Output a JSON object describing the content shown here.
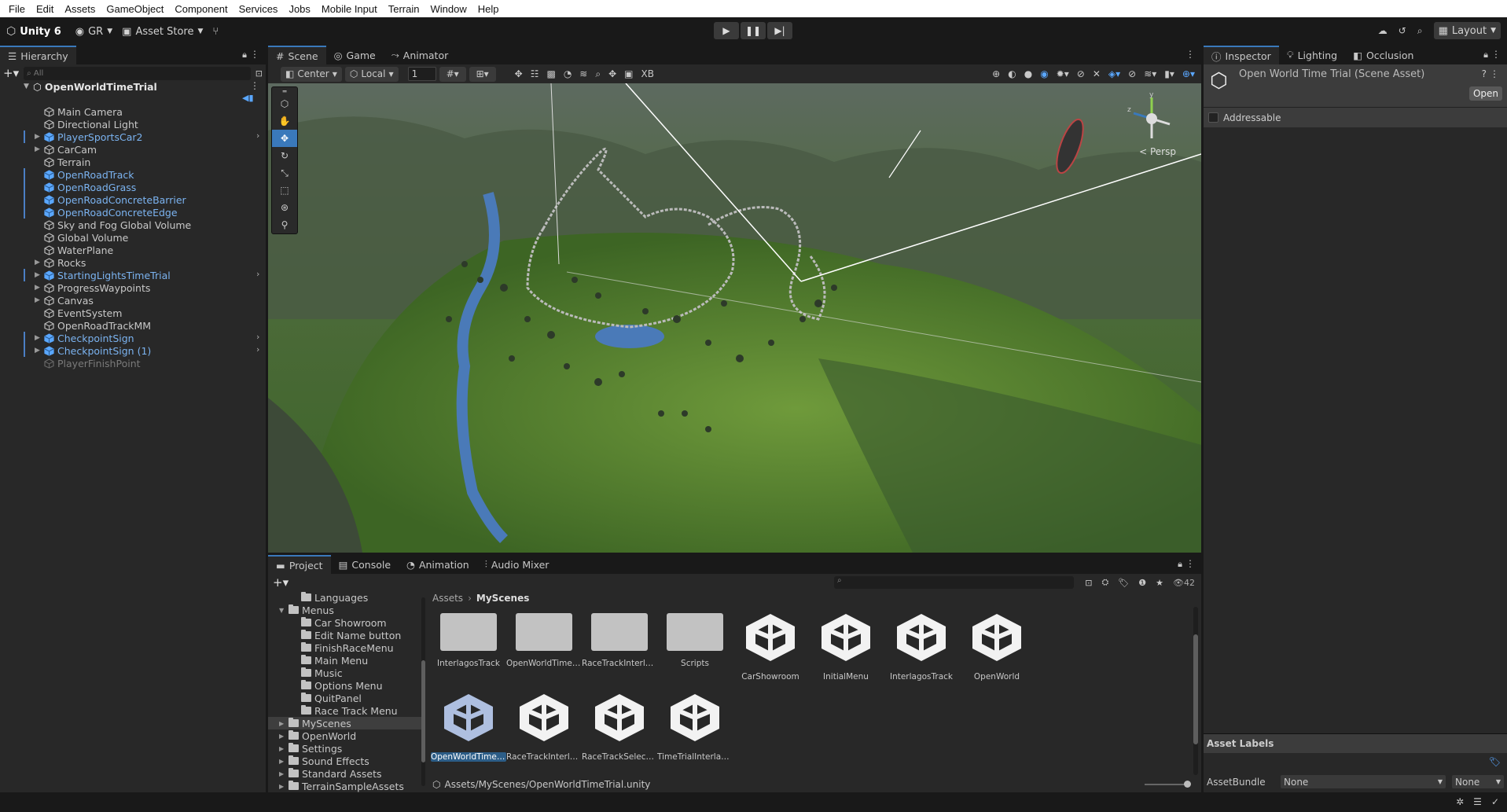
{
  "menu": [
    "File",
    "Edit",
    "Assets",
    "GameObject",
    "Component",
    "Services",
    "Jobs",
    "Mobile Input",
    "Terrain",
    "Window",
    "Help"
  ],
  "toolbar": {
    "unity_label": "Unity 6",
    "account": "GR",
    "asset_store": "Asset Store",
    "layout": "Layout"
  },
  "hierarchy": {
    "tab": "Hierarchy",
    "search_placeholder": "All",
    "scene": "OpenWorldTimeTrial",
    "items": [
      {
        "label": "Main Camera",
        "style": "normal",
        "expand": false
      },
      {
        "label": "Directional Light",
        "style": "normal",
        "expand": false
      },
      {
        "label": "PlayerSportsCar2",
        "style": "prefab",
        "expand": true
      },
      {
        "label": "CarCam",
        "style": "normal",
        "expand": true
      },
      {
        "label": "Terrain",
        "style": "normal",
        "expand": false
      },
      {
        "label": "OpenRoadTrack",
        "style": "prefab",
        "expand": false
      },
      {
        "label": "OpenRoadGrass",
        "style": "prefab",
        "expand": false
      },
      {
        "label": "OpenRoadConcreteBarrier",
        "style": "prefab",
        "expand": false
      },
      {
        "label": "OpenRoadConcreteEdge",
        "style": "prefab",
        "expand": false
      },
      {
        "label": "Sky and Fog Global Volume",
        "style": "normal",
        "expand": false
      },
      {
        "label": "Global Volume",
        "style": "normal",
        "expand": false
      },
      {
        "label": "WaterPlane",
        "style": "normal",
        "expand": false
      },
      {
        "label": "Rocks",
        "style": "normal",
        "expand": true
      },
      {
        "label": "StartingLightsTimeTrial",
        "style": "prefab",
        "expand": true
      },
      {
        "label": "ProgressWaypoints",
        "style": "normal",
        "expand": true
      },
      {
        "label": "Canvas",
        "style": "normal",
        "expand": true
      },
      {
        "label": "EventSystem",
        "style": "normal",
        "expand": false
      },
      {
        "label": "OpenRoadTrackMM",
        "style": "normal",
        "expand": false
      },
      {
        "label": "CheckpointSign",
        "style": "prefab",
        "expand": true
      },
      {
        "label": "CheckpointSign (1)",
        "style": "prefab",
        "expand": true
      },
      {
        "label": "PlayerFinishPoint",
        "style": "disabled",
        "expand": false
      }
    ]
  },
  "scene_view": {
    "tabs": [
      "Scene",
      "Game",
      "Animator"
    ],
    "pivot": "Center",
    "space": "Local",
    "grid_value": "1",
    "xr_label": "XB",
    "persp_label": "< Persp"
  },
  "inspector": {
    "tabs": [
      "Inspector",
      "Lighting",
      "Occlusion"
    ],
    "title": "Open World Time Trial (Scene Asset)",
    "open_button": "Open",
    "addressable": "Addressable",
    "asset_labels": "Asset Labels",
    "asset_bundle_label": "AssetBundle",
    "asset_bundle_value": "None",
    "asset_bundle_variant": "None"
  },
  "project": {
    "tabs": [
      "Project",
      "Console",
      "Animation",
      "Audio Mixer"
    ],
    "count": "42",
    "tree": [
      {
        "label": "Languages",
        "indent": 2,
        "expand": ""
      },
      {
        "label": "Menus",
        "indent": 1,
        "expand": "▼"
      },
      {
        "label": "Car Showroom",
        "indent": 2,
        "expand": ""
      },
      {
        "label": "Edit Name button",
        "indent": 2,
        "expand": ""
      },
      {
        "label": "FinishRaceMenu",
        "indent": 2,
        "expand": ""
      },
      {
        "label": "Main Menu",
        "indent": 2,
        "expand": ""
      },
      {
        "label": "Music",
        "indent": 2,
        "expand": ""
      },
      {
        "label": "Options Menu",
        "indent": 2,
        "expand": ""
      },
      {
        "label": "QuitPanel",
        "indent": 2,
        "expand": ""
      },
      {
        "label": "Race Track Menu",
        "indent": 2,
        "expand": ""
      },
      {
        "label": "MyScenes",
        "indent": 1,
        "expand": "▶",
        "selected": true
      },
      {
        "label": "OpenWorld",
        "indent": 1,
        "expand": "▶"
      },
      {
        "label": "Settings",
        "indent": 1,
        "expand": "▶"
      },
      {
        "label": "Sound Effects",
        "indent": 1,
        "expand": "▶"
      },
      {
        "label": "Standard Assets",
        "indent": 1,
        "expand": "▶"
      },
      {
        "label": "TerrainSampleAssets",
        "indent": 1,
        "expand": "▶"
      }
    ],
    "breadcrumb": [
      "Assets",
      "MyScenes"
    ],
    "assets": [
      {
        "label": "InterlagosTrack",
        "kind": "folder"
      },
      {
        "label": "OpenWorldTimeTrial",
        "kind": "folder"
      },
      {
        "label": "RaceTrackInterlag...",
        "kind": "folder"
      },
      {
        "label": "Scripts",
        "kind": "folder"
      },
      {
        "label": "CarShowroom",
        "kind": "scene"
      },
      {
        "label": "InitialMenu",
        "kind": "scene"
      },
      {
        "label": "InterlagosTrack",
        "kind": "scene"
      },
      {
        "label": "OpenWorld",
        "kind": "scene"
      },
      {
        "label": "OpenWorldTimeTrial",
        "kind": "scene",
        "selected": true
      },
      {
        "label": "RaceTrackInterlag...",
        "kind": "scene"
      },
      {
        "label": "RaceTrackSelection",
        "kind": "scene"
      },
      {
        "label": "TimeTrialInterlagos",
        "kind": "scene"
      }
    ],
    "path": "Assets/MyScenes/OpenWorldTimeTrial.unity"
  },
  "colors": {
    "accent": "#3a79bb",
    "prefab_text": "#7bb3f0",
    "panel": "#282828",
    "background": "#191919",
    "water": "#4a7ab8",
    "grass": "#4c7a2c"
  }
}
